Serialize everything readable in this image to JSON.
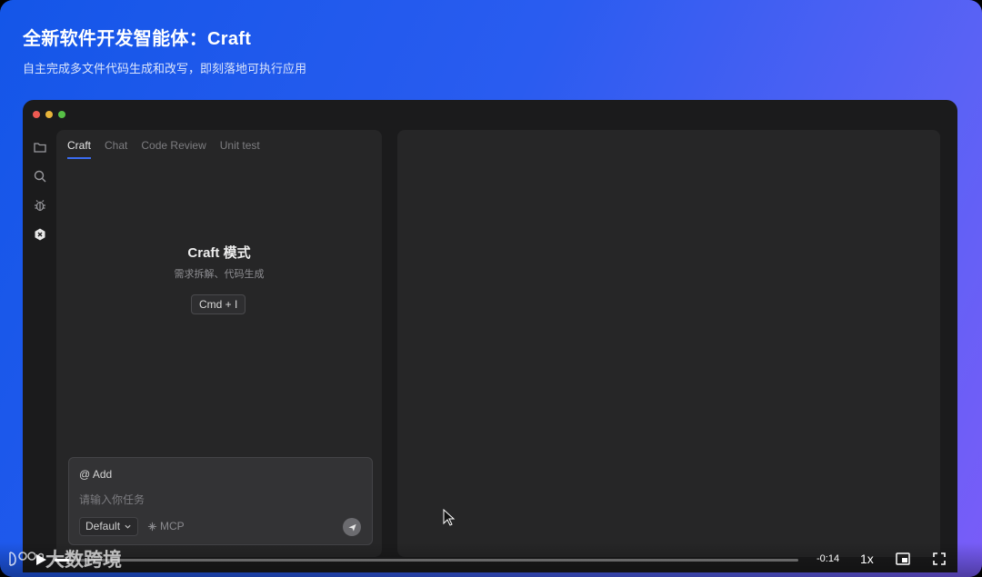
{
  "hero": {
    "title": "全新软件开发智能体：Craft",
    "subtitle": "自主完成多文件代码生成和改写，即刻落地可执行应用"
  },
  "activity_bar": {
    "icons": [
      "folder-icon",
      "search-icon",
      "bug-icon",
      "craft-agent-icon"
    ]
  },
  "tabs": [
    {
      "label": "Craft",
      "active": true
    },
    {
      "label": "Chat",
      "active": false
    },
    {
      "label": "Code Review",
      "active": false
    },
    {
      "label": "Unit test",
      "active": false
    }
  ],
  "mode": {
    "title": "Craft 模式",
    "subtitle": "需求拆解、代码生成",
    "shortcut": "Cmd + I"
  },
  "composer": {
    "add_label": "@ Add",
    "placeholder": "请输入你任务",
    "model": "Default",
    "mcp_label": "MCP"
  },
  "video": {
    "watermark": "大数跨境",
    "time": "-0:14",
    "speed": "1x",
    "progress": 0.02
  },
  "colors": {
    "accent": "#3b6cf0",
    "window_bg": "#1b1b1c",
    "panel_bg": "#262627"
  }
}
